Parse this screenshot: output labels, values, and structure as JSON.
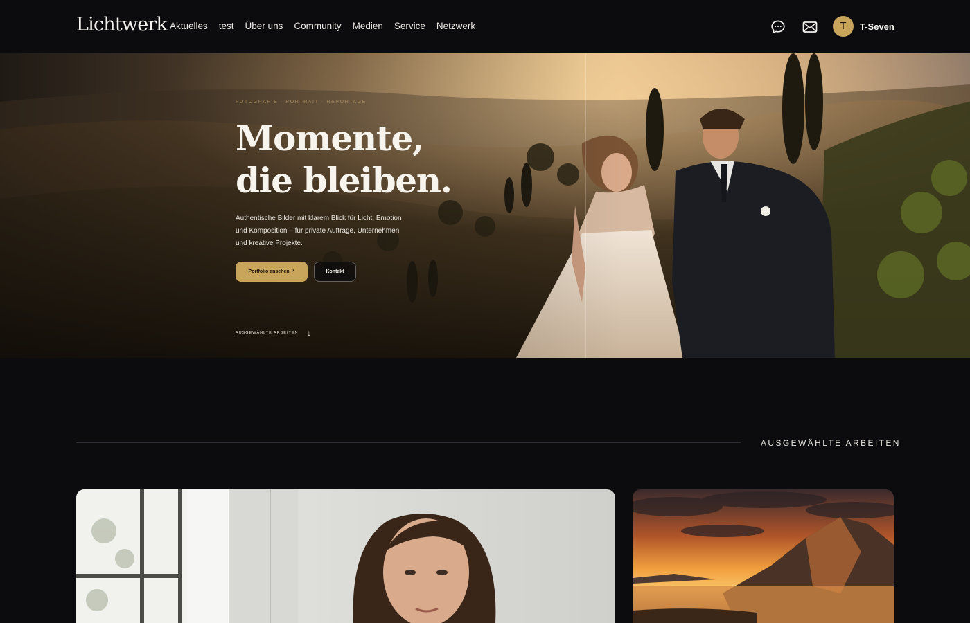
{
  "header": {
    "brand": "Lichtwerk",
    "nav": [
      "Aktuelles",
      "test",
      "Über uns",
      "Community",
      "Medien",
      "Service",
      "Netzwerk"
    ],
    "icons": [
      "chat-icon",
      "mail-icon"
    ],
    "user": {
      "initial": "T",
      "name": "T-Seven"
    }
  },
  "hero": {
    "eyebrow": "FOTOGRAFIE · PORTRAIT · REPORTAGE",
    "title": "Momente, die bleiben.",
    "text": "Authentische Bilder mit klarem Blick für Licht, Emotion und Komposition – für private Aufträge, Unternehmen und kreative Projekte.",
    "primary_button": "Portfolio ansehen ↗",
    "secondary_button": "Kontakt",
    "scroll_label": "AUSGEWÄHLTE ARBEITEN",
    "scroll_arrow": "↓"
  },
  "section": {
    "label": "AUSGEWÄHLTE ARBEITEN"
  },
  "colors": {
    "background": "#0c0c0f",
    "accent": "#c9a55b",
    "text": "#f2f0ec"
  }
}
